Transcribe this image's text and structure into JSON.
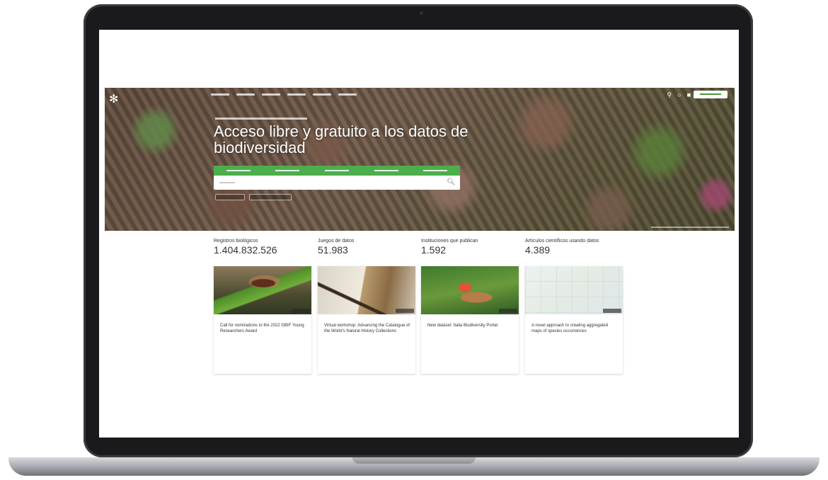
{
  "hero": {
    "title": "Acceso libre y gratuito a los datos de biodiversidad",
    "icons": [
      "person-icon",
      "search-icon",
      "menu-icon"
    ]
  },
  "stats": [
    {
      "label": "Registros biológicos",
      "value": "1.404.832.526"
    },
    {
      "label": "Juegos de datos",
      "value": "51.983"
    },
    {
      "label": "Instituciones que publican",
      "value": "1.592"
    },
    {
      "label": "Artículos científicos usando datos",
      "value": "4.389"
    }
  ],
  "news": [
    {
      "title": "Call for nominations to the 2022 GBIF Young Researchers Award",
      "description": ""
    },
    {
      "title": "Virtual workshop: Advancing the Catalogue of the World's Natural History Collections",
      "description": ""
    },
    {
      "title": "New dataset: Italia Biodiversity Portal",
      "description": ""
    },
    {
      "title": "A novel approach to creating aggregated maps of species occurrences",
      "description": ""
    }
  ],
  "colors": {
    "brand_green": "#4cae4c",
    "text": "#333333",
    "frame": "#1a1a1c"
  }
}
